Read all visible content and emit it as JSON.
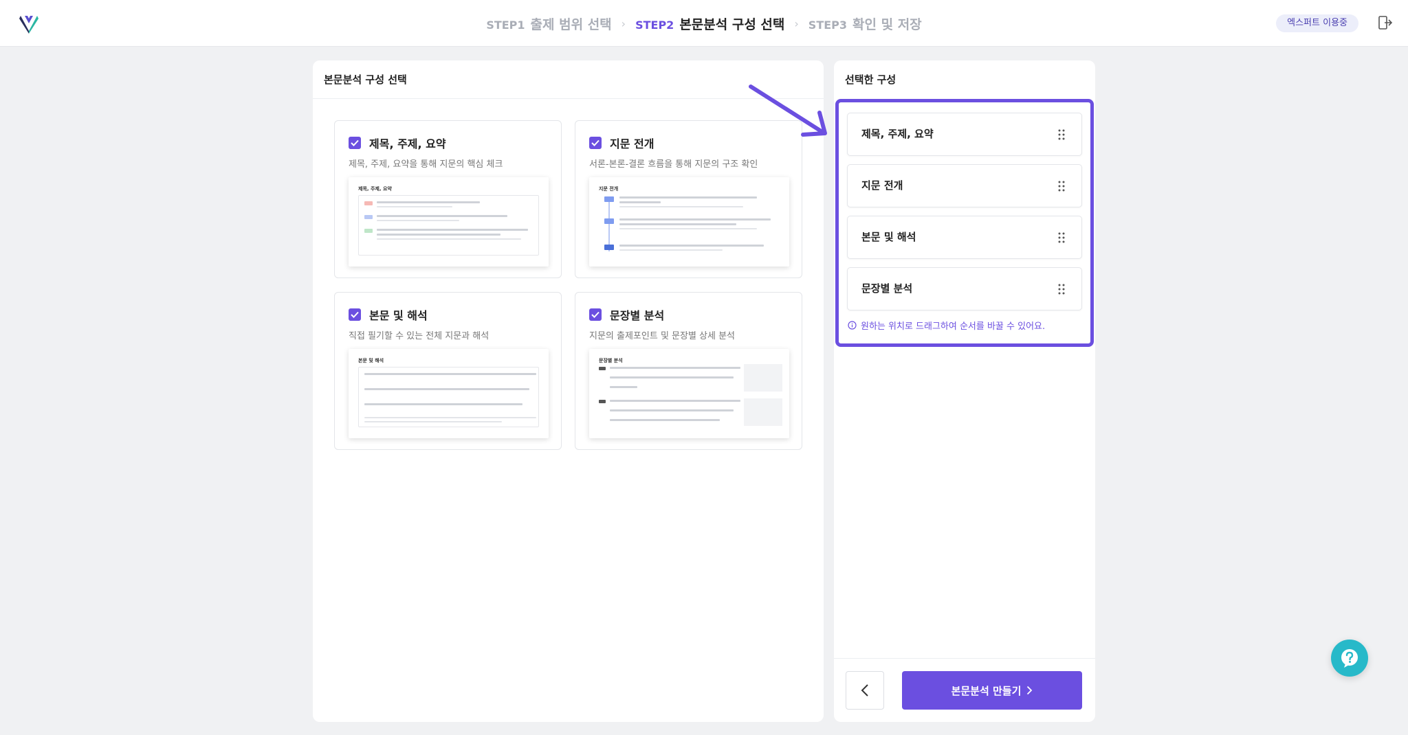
{
  "header": {
    "steps": [
      {
        "num": "STEP1",
        "name": "출제 범위 선택"
      },
      {
        "num": "STEP2",
        "name": "본문분석 구성 선택"
      },
      {
        "num": "STEP3",
        "name": "확인 및 저장"
      }
    ],
    "active_step": 1,
    "badge": "엑스퍼트 이용중"
  },
  "left_panel": {
    "title": "본문분석 구성 선택",
    "cards": [
      {
        "title": "제목, 주제, 요약",
        "desc": "제목, 주제, 요약을 통해 지문의 핵심 체크",
        "checked": true,
        "thumb_title": "제목, 주제, 요약"
      },
      {
        "title": "지문 전개",
        "desc": "서론-본론-결론 흐름을 통해 지문의 구조 확인",
        "checked": true,
        "thumb_title": "지문 전개"
      },
      {
        "title": "본문 및 해석",
        "desc": "직접 필기할 수 있는 전체 지문과 해석",
        "checked": true,
        "thumb_title": "본문 및 해석"
      },
      {
        "title": "문장별 분석",
        "desc": "지문의 출제포인트 및 문장별 상세 분석",
        "checked": true,
        "thumb_title": "문장별 분석"
      }
    ]
  },
  "right_panel": {
    "title": "선택한 구성",
    "items": [
      "제목, 주제, 요약",
      "지문 전개",
      "본문 및 해석",
      "문장별 분석"
    ],
    "hint": "원하는 위치로 드래그하여 순서를 바꿀 수 있어요.",
    "make_button": "본문분석 만들기"
  },
  "colors": {
    "accent": "#6b4fe0",
    "help": "#27b9c9"
  }
}
